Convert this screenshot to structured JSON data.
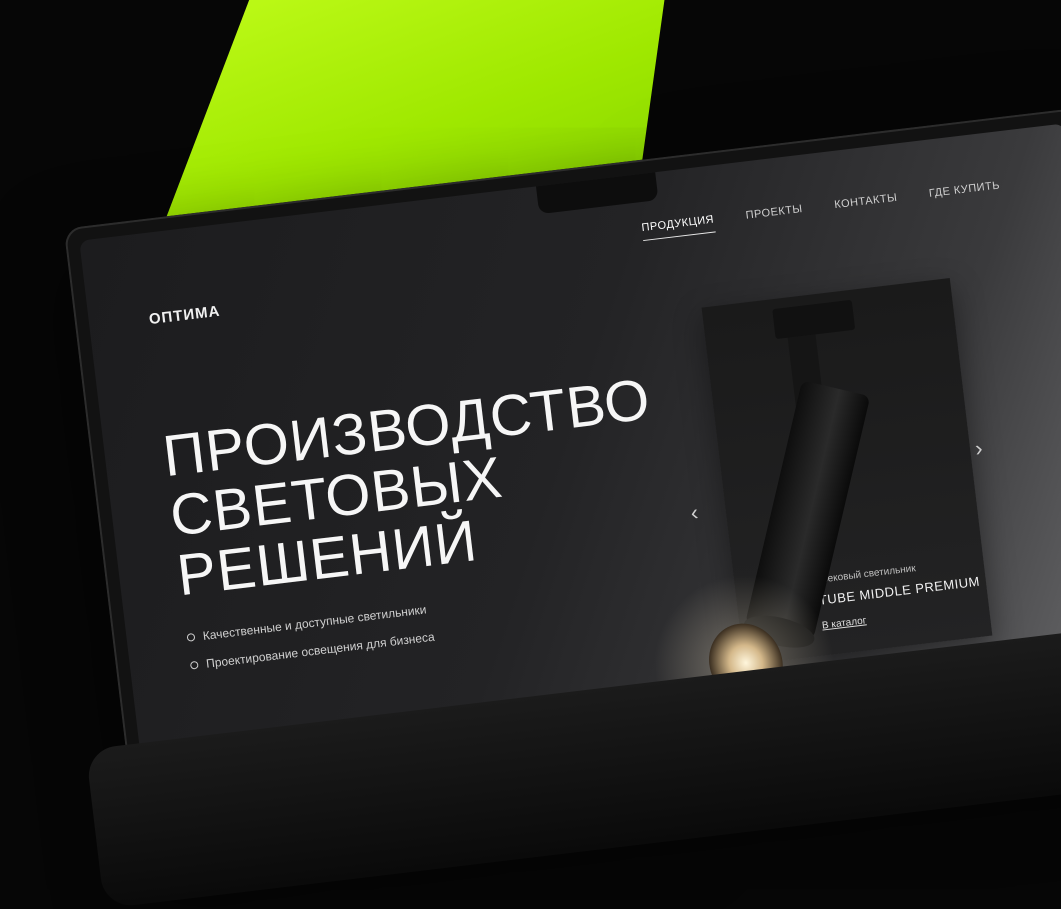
{
  "brand": {
    "logo": "ОПТИМА"
  },
  "nav": [
    {
      "label": "ПРОДУКЦИЯ",
      "active": true
    },
    {
      "label": "ПРОЕКТЫ",
      "active": false
    },
    {
      "label": "КОНТАКТЫ",
      "active": false
    },
    {
      "label": "ГДЕ КУПИТЬ",
      "active": false
    }
  ],
  "hero": {
    "line1": "ПРОИЗВОДСТВО",
    "line2": "СВЕТОВЫХ",
    "line3": "РЕШЕНИЙ",
    "bullets": [
      "Качественные и доступные светильники",
      "Проектирование освещения для бизнеса"
    ]
  },
  "product_card": {
    "category": "Трековый светильник",
    "title": "TUBE MIDDLE PREMIUM",
    "link": "В каталог"
  },
  "icons": {
    "prev": "chevron-left-icon",
    "next": "chevron-right-icon"
  },
  "colors": {
    "accent": "#a6f000",
    "background": "#060606",
    "screen": "#232325"
  }
}
